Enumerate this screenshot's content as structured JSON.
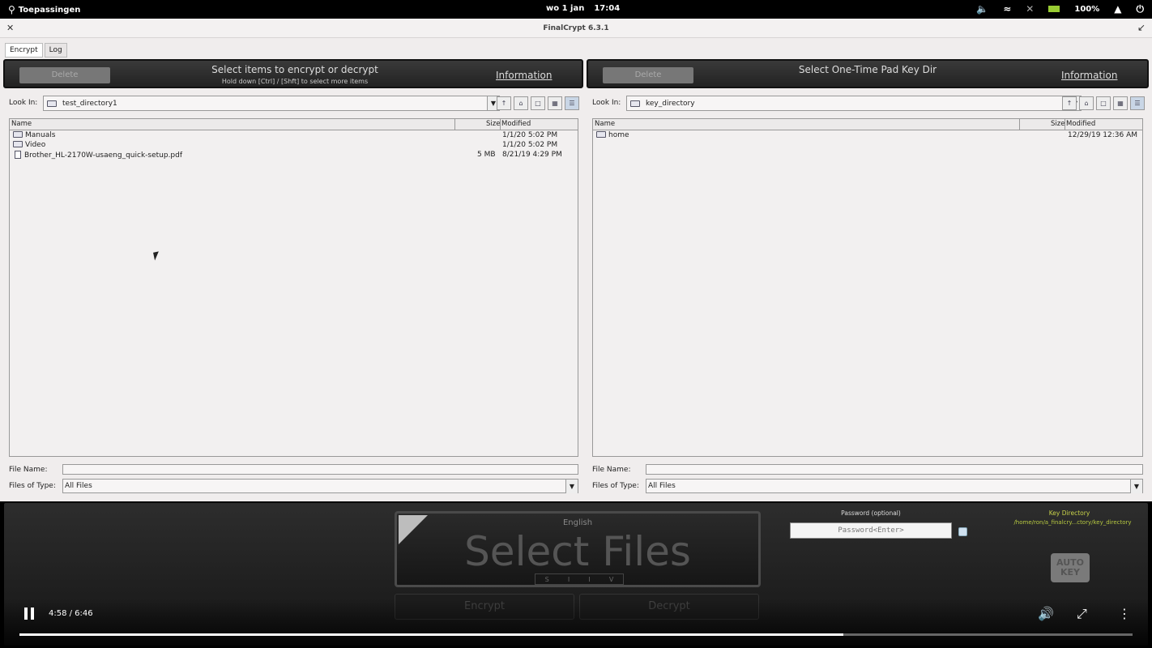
{
  "topbar": {
    "apps_label": "Toepassingen",
    "date": "wo  1 jan",
    "time": "17:04",
    "battery": "100%"
  },
  "window": {
    "title": "FinalCrypt 6.3.1",
    "tabs": [
      "Encrypt",
      "Log"
    ]
  },
  "left_header": {
    "delete_label": "Delete",
    "title": "Select items to encrypt or decrypt",
    "subtitle": "Hold down [Ctrl] / [Shft] to select more items",
    "info_label": "Information"
  },
  "right_header": {
    "delete_label": "Delete",
    "title": "Select One-Time Pad Key Dir",
    "info_label": "Information"
  },
  "left_chooser": {
    "look_in_label": "Look In:",
    "look_in_value": "test_directory1",
    "columns": [
      "Name",
      "Size",
      "Modified"
    ],
    "rows": [
      {
        "name": "Manuals",
        "size": "",
        "modified": "1/1/20 5:02 PM",
        "type": "folder"
      },
      {
        "name": "Video",
        "size": "",
        "modified": "1/1/20 5:02 PM",
        "type": "folder"
      },
      {
        "name": "Brother_HL-2170W-usaeng_quick-setup.pdf",
        "size": "5 MB",
        "modified": "8/21/19 4:29 PM",
        "type": "file"
      }
    ],
    "file_name_label": "File Name:",
    "file_name_value": "",
    "files_of_type_label": "Files of Type:",
    "files_of_type_value": "All Files"
  },
  "right_chooser": {
    "look_in_label": "Look In:",
    "look_in_value": "key_directory",
    "columns": [
      "Name",
      "Size",
      "Modified"
    ],
    "rows": [
      {
        "name": "home",
        "size": "",
        "modified": "12/29/19 12:36 AM",
        "type": "folder"
      }
    ],
    "file_name_label": "File Name:",
    "file_name_value": "",
    "files_of_type_label": "Files of Type:",
    "files_of_type_value": "All Files"
  },
  "bottom": {
    "language": "English",
    "main_label": "Select Files",
    "indicators": [
      "S",
      "I",
      "I",
      "V"
    ],
    "encrypt_label": "Encrypt",
    "decrypt_label": "Decrypt",
    "password_label": "Password (optional)",
    "password_placeholder": "Password<Enter>",
    "key_dir_label": "Key Directory",
    "key_dir_path": "/home/ron/a_finalcry...ctory/key_directory",
    "auto_key_line1": "AUTO",
    "auto_key_line2": "KEY"
  },
  "video": {
    "time_display": "4:58 / 6:46",
    "progress_fraction": 0.74
  }
}
